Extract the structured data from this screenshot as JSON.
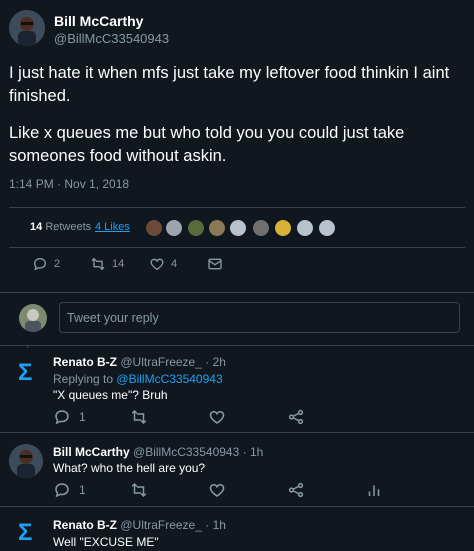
{
  "tweet": {
    "author_name": "Bill McCarthy",
    "author_handle": "@BillMcC33540943",
    "text_p1": "I just hate it when mfs just take my leftover food thinkin I aint finished.",
    "text_p2": "Like x queues me but who told you you could just take someones food without askin.",
    "timestamp": "1:14 PM · Nov 1, 2018",
    "retweets_count": "14",
    "retweets_label": "Retweets",
    "likes_label": "4 Likes",
    "actions": {
      "replies": "2",
      "retweets": "14",
      "likes": "4"
    }
  },
  "compose": {
    "placeholder": "Tweet your reply"
  },
  "replies": [
    {
      "author_name": "Renato B-Z",
      "author_handle": "@UltraFreeze_",
      "time": "· 2h",
      "replying_prefix": "Replying to",
      "replying_to": "@BillMcC33540943",
      "text": "\"X queues me\"? Bruh",
      "reply_count": "1",
      "avatar_letter": "Σ"
    },
    {
      "author_name": "Bill McCarthy",
      "author_handle": "@BillMcC33540943",
      "time": "· 1h",
      "text": "What? who the hell are you?",
      "reply_count": "1"
    },
    {
      "author_name": "Renato B-Z",
      "author_handle": "@UltraFreeze_",
      "time": "· 1h",
      "text": "Well \"EXCUSE ME\"",
      "avatar_letter": "Σ"
    }
  ],
  "colors": {
    "background": "#10171e",
    "accent": "#1da1f2",
    "muted": "#8899a6",
    "divider": "#38444d"
  }
}
